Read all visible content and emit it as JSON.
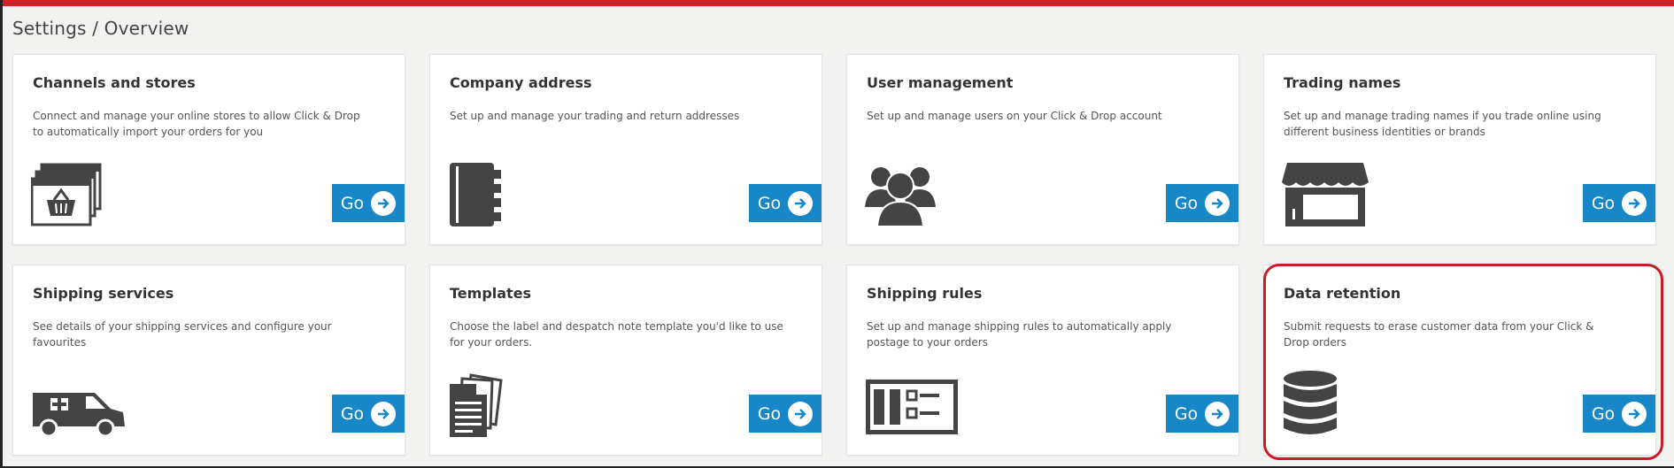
{
  "breadcrumb": "Settings / Overview",
  "go_label": "Go",
  "colors": {
    "accent": "#d1202a",
    "button": "#1787c8",
    "highlight": "#c91c24"
  },
  "cards": [
    {
      "title": "Channels and stores",
      "description": "Connect and manage your online stores to allow Click & Drop to automatically import your orders for you",
      "icon": "browser-basket-icon"
    },
    {
      "title": "Company address",
      "description": "Set up and manage your trading and return addresses",
      "icon": "address-book-icon"
    },
    {
      "title": "User management",
      "description": "Set up and manage users on your Click & Drop account",
      "icon": "users-icon"
    },
    {
      "title": "Trading names",
      "description": "Set up and manage trading names if you trade online using different business identities or brands",
      "icon": "storefront-icon"
    },
    {
      "title": "Shipping services",
      "description": "See details of your shipping services and configure your favourites",
      "icon": "van-icon"
    },
    {
      "title": "Templates",
      "description": "Choose the label and despatch note template you'd like to use for your orders.",
      "icon": "documents-icon"
    },
    {
      "title": "Shipping rules",
      "description": "Set up and manage shipping rules to automatically apply postage to your orders",
      "icon": "rules-board-icon"
    },
    {
      "title": "Data retention",
      "description": "Submit requests to erase customer data from your Click & Drop orders",
      "icon": "database-icon"
    }
  ]
}
